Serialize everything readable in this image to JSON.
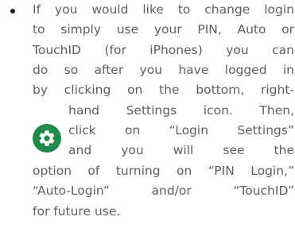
{
  "instructions": {
    "lines": [
      "If you would like to change login",
      "to simply use your PIN, Auto or",
      "TouchID (for iPhones) you can",
      "do so after you have logged in",
      "by clicking on the bottom, right-",
      "hand Settings icon. Then,",
      "click on “Login Settings”",
      "and you will see the",
      "option of turning on “PIN Login,”",
      "“Auto-Login” and/or “TouchID”",
      "for future use."
    ]
  },
  "icons": {
    "settings_icon": "gear-icon",
    "settings_badge_color": "#1f8a4c"
  },
  "colors": {
    "text": "#5f5f5f",
    "bullet": "#1c1c1c"
  }
}
